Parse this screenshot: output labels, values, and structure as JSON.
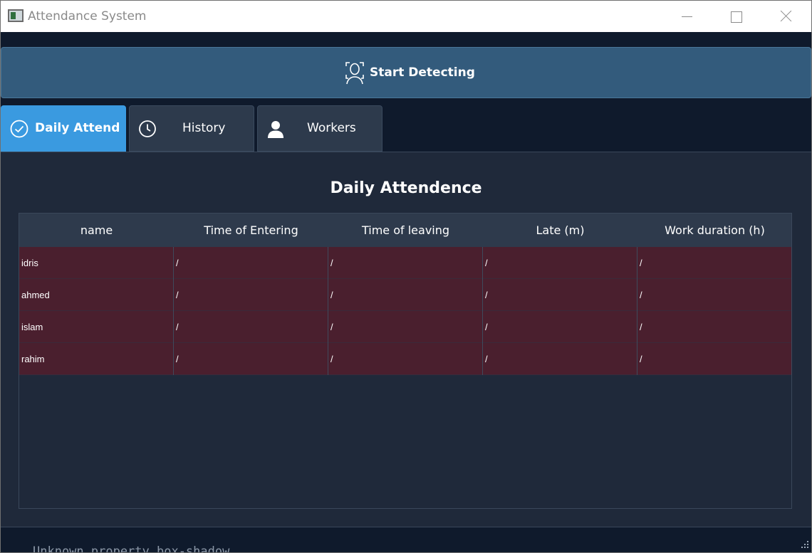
{
  "window": {
    "title": "Attendance System"
  },
  "detect_button": {
    "label": "Start Detecting"
  },
  "tabs": [
    {
      "label": "Daily Attend",
      "icon": "check-circle-icon",
      "active": true
    },
    {
      "label": "History",
      "icon": "clock-icon",
      "active": false
    },
    {
      "label": "Workers",
      "icon": "person-icon",
      "active": false
    }
  ],
  "panel": {
    "heading": "Daily Attendence",
    "columns": [
      "name",
      "Time of Entering",
      "Time of leaving",
      "Late (m)",
      "Work duration (h)"
    ],
    "rows": [
      [
        "idris",
        "/",
        "/",
        "/",
        "/"
      ],
      [
        "ahmed",
        "/",
        "/",
        "/",
        "/"
      ],
      [
        "islam",
        "/",
        "/",
        "/",
        "/"
      ],
      [
        "rahim",
        "/",
        "/",
        "/",
        "/"
      ]
    ]
  },
  "console": {
    "text": "Unknown property box-shadow"
  },
  "colors": {
    "background": "#0f1a2c",
    "panel": "#1f293a",
    "button": "#335b7c",
    "active_tab": "#3a9ae0",
    "absent_row": "#4a1f2e"
  }
}
